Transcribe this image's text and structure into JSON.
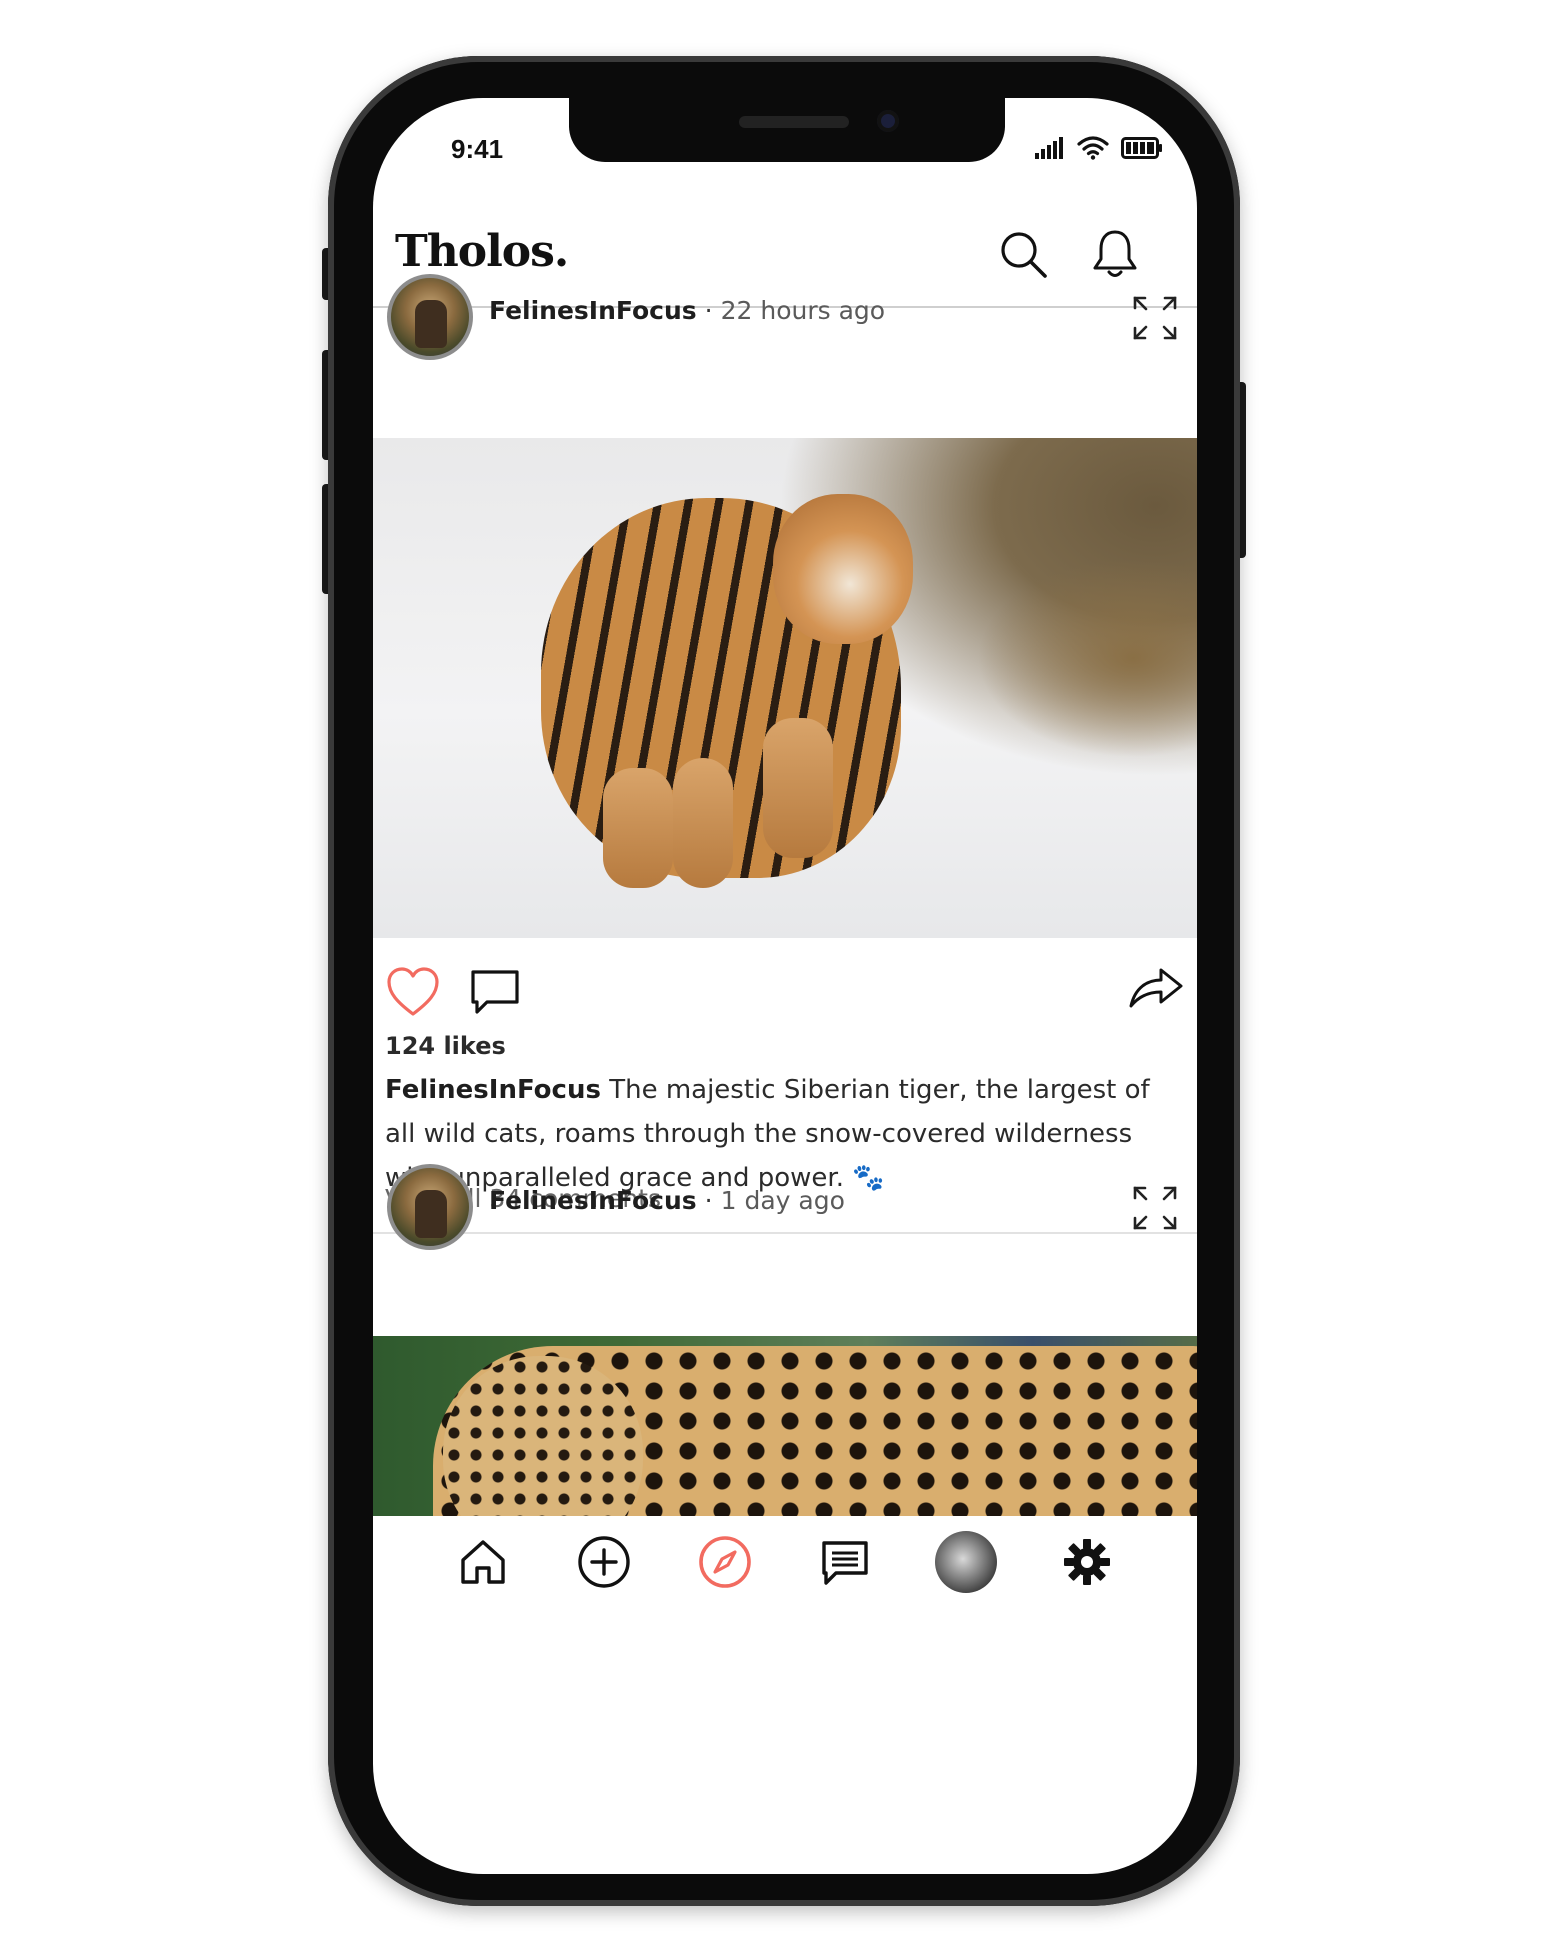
{
  "status_bar": {
    "time": "9:41"
  },
  "app": {
    "logo": "Tholos."
  },
  "posts": [
    {
      "user": "FelinesInFocus",
      "time": "22 hours ago",
      "likes": "124 likes",
      "caption": "The majestic Siberian tiger, the largest of all wild cats, roams through the snow-covered wilderness with unparalleled grace and power. 🐾",
      "comments": "View all 34 comments"
    },
    {
      "user": "FelinesInFocus",
      "time": "1 day ago"
    }
  ],
  "colors": {
    "accent": "#f26b60",
    "text": "#111111"
  },
  "icons": {
    "header": [
      "search-icon",
      "bell-icon"
    ],
    "nav": [
      "home-icon",
      "add-icon",
      "compass-icon",
      "messages-icon",
      "profile-avatar",
      "settings-icon"
    ]
  }
}
